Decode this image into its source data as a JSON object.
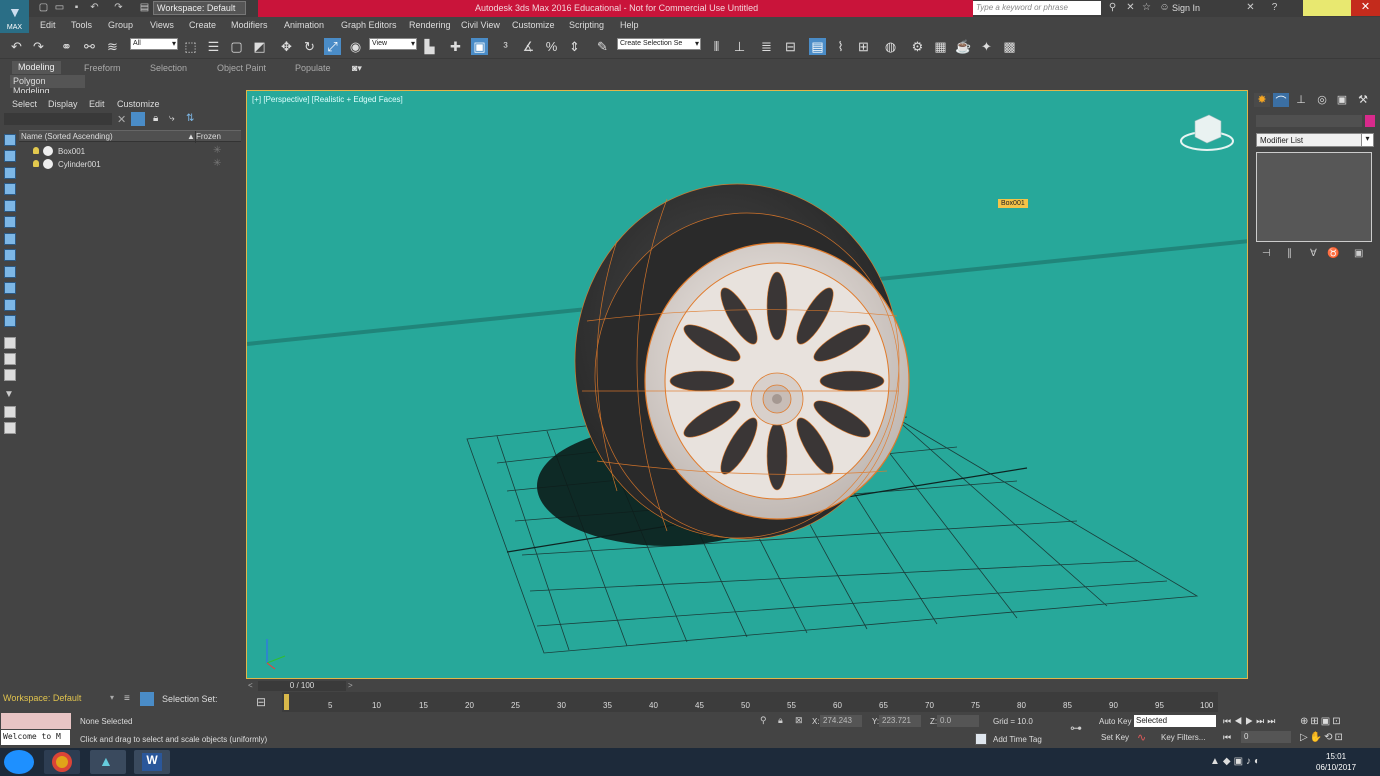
{
  "titlebar": {
    "title": "Autodesk 3ds Max 2016 Educational - Not for Commercial Use   Untitled",
    "workspace": "Workspace: Default",
    "search_placeholder": "Type a keyword or phrase",
    "sign_in": "Sign In",
    "logo_text": "MAX"
  },
  "menu": [
    "Edit",
    "Tools",
    "Group",
    "Views",
    "Create",
    "Modifiers",
    "Animation",
    "Graph Editors",
    "Rendering",
    "Civil View",
    "Customize",
    "Scripting",
    "Help"
  ],
  "toolbar": {
    "filter_value": "All",
    "ref_coord_value": "View",
    "selection_set_value": "Create Selection Se"
  },
  "ribbon": {
    "tabs": [
      "Modeling",
      "Freeform",
      "Selection",
      "Object Paint",
      "Populate"
    ],
    "sub_label": "Polygon Modeling"
  },
  "explorer": {
    "menu": [
      "Select",
      "Display",
      "Edit",
      "Customize"
    ],
    "col_name": "Name (Sorted Ascending)",
    "col_frozen": "Frozen",
    "rows": [
      {
        "name": "Box001"
      },
      {
        "name": "Cylinder001"
      }
    ]
  },
  "viewport": {
    "label": "[+] [Perspective] [Realistic + Edged Faces]",
    "object_label": "Box001",
    "colors": {
      "background": "#27a89a",
      "selection_border": "#e3b649",
      "edge": "#e07a2a"
    }
  },
  "command_panel": {
    "modifier_list": "Modifier List"
  },
  "timeline": {
    "frame": "0 / 100",
    "ticks": [
      "5",
      "10",
      "15",
      "20",
      "25",
      "30",
      "35",
      "40",
      "45",
      "50",
      "55",
      "60",
      "65",
      "70",
      "75",
      "80",
      "85",
      "90",
      "95",
      "100"
    ]
  },
  "status": {
    "workspace": "Workspace: Default",
    "selection_set": "Selection Set:",
    "welcome": "Welcome to M",
    "selection": "None Selected",
    "prompt": "Click and drag to select and scale objects (uniformly)",
    "x_label": "X:",
    "x": "274.243",
    "y_label": "Y:",
    "y": "223.721",
    "z_label": "Z:",
    "z": "0.0",
    "grid": "Grid = 10.0",
    "add_time_tag": "Add Time Tag",
    "auto_key": "Auto Key",
    "set_key": "Set Key",
    "selected": "Selected",
    "key_filters": "Key Filters...",
    "frame_input": "0"
  },
  "taskbar": {
    "time": "15:01",
    "date": "06/10/2017"
  }
}
